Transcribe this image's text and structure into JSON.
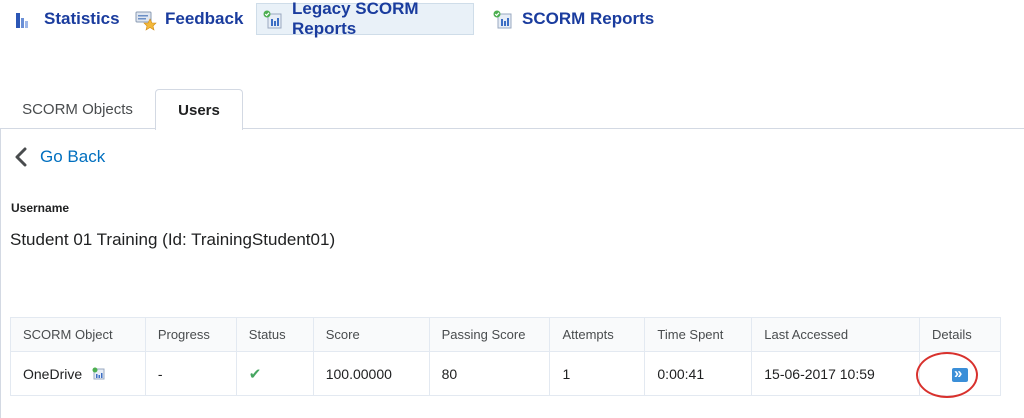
{
  "nav": {
    "items": [
      {
        "label": "Statistics",
        "icon": "bar-chart-icon"
      },
      {
        "label": "Feedback",
        "icon": "feedback-icon"
      },
      {
        "label": "Legacy SCORM Reports",
        "icon": "scorm-report-icon",
        "active": true
      },
      {
        "label": "SCORM Reports",
        "icon": "scorm-report-icon"
      }
    ]
  },
  "tabs": [
    {
      "label": "SCORM Objects",
      "selected": false
    },
    {
      "label": "Users",
      "selected": true
    }
  ],
  "go_back": "Go Back",
  "username_label": "Username",
  "username_value": "Student 01 Training (Id: TrainingStudent01)",
  "table": {
    "headers": [
      "SCORM Object",
      "Progress",
      "Status",
      "Score",
      "Passing Score",
      "Attempts",
      "Time Spent",
      "Last Accessed",
      "Details"
    ],
    "rows": [
      {
        "scorm_object": "OneDrive",
        "progress": "-",
        "status_icon": "checkmark-icon",
        "score": "100.00000",
        "passing_score": "80",
        "attempts": "1",
        "time_spent": "0:00:41",
        "last_accessed": "15-06-2017 10:59",
        "details_icon": "double-chevron-right-icon"
      }
    ]
  },
  "colors": {
    "nav_text": "#1a3c9e",
    "link": "#006fbf",
    "status_ok": "#46a661",
    "highlight_circle": "#d8312d",
    "details_button": "#3b8fd8"
  }
}
